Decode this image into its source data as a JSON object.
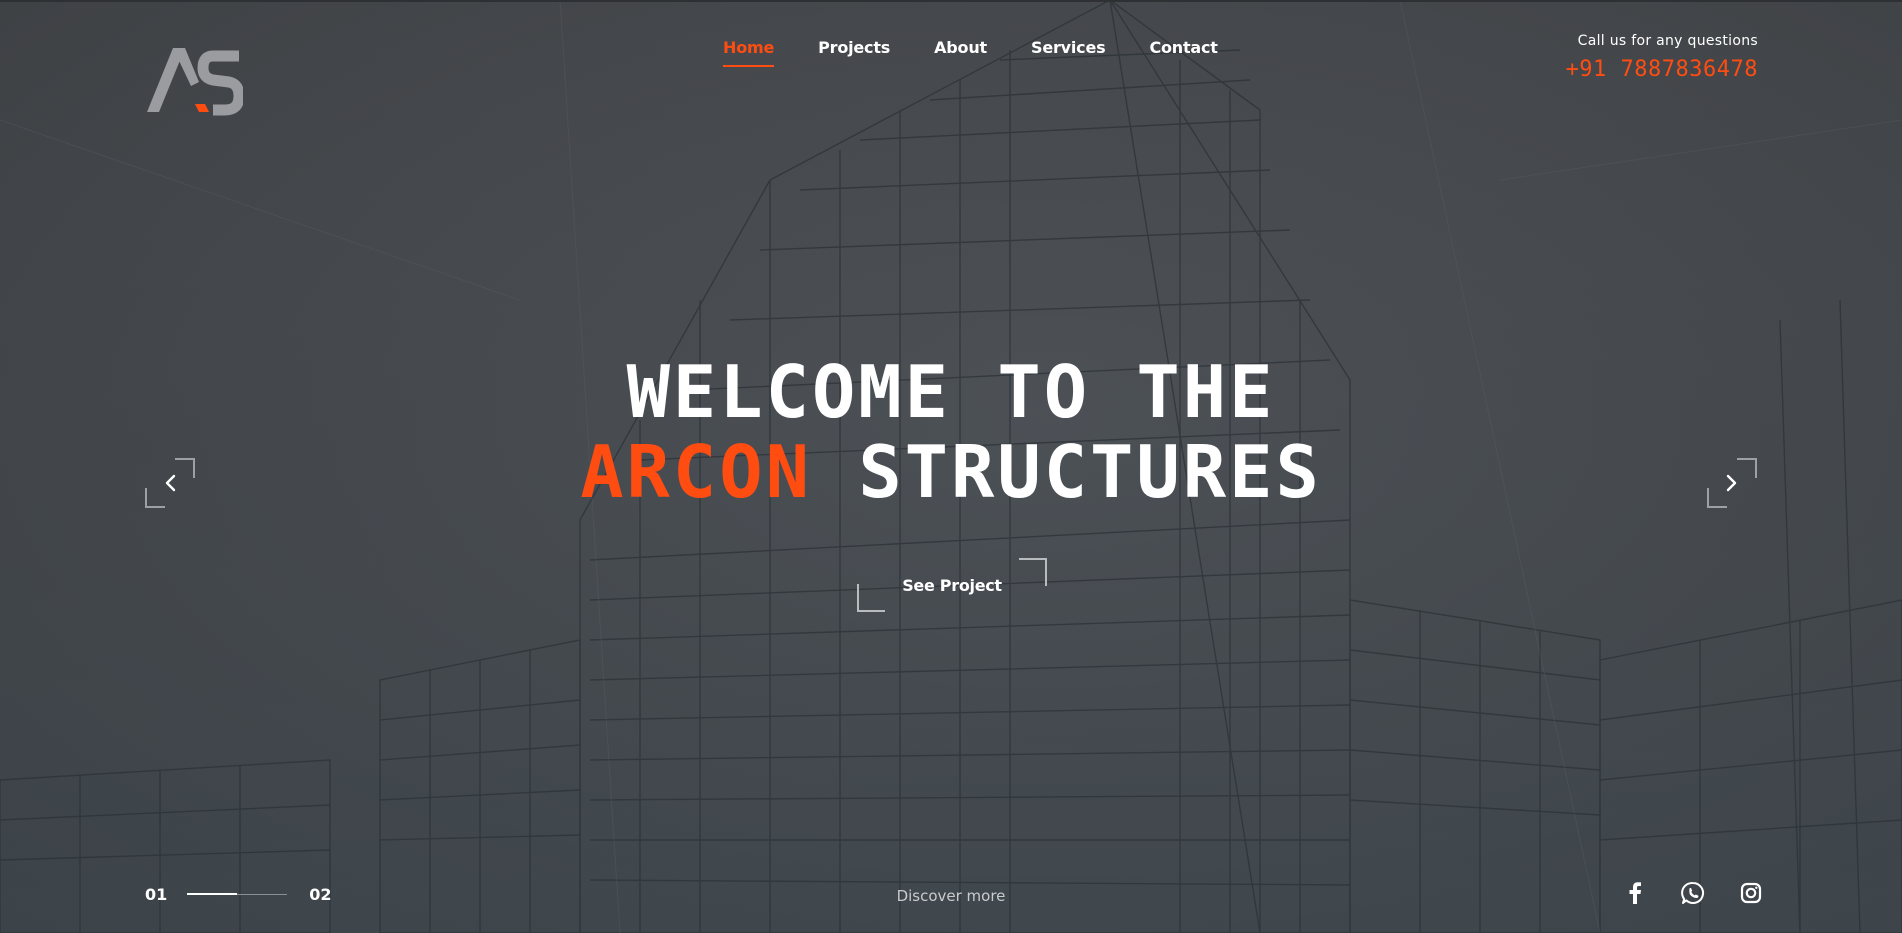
{
  "brand": {
    "logo_text": "AS",
    "accent_color": "#ff4d12"
  },
  "nav": {
    "items": [
      {
        "label": "Home",
        "active": true
      },
      {
        "label": "Projects",
        "active": false
      },
      {
        "label": "About",
        "active": false
      },
      {
        "label": "Services",
        "active": false
      },
      {
        "label": "Contact",
        "active": false
      }
    ]
  },
  "contact": {
    "label": "Call us for any questions",
    "phone": "+91 7887836478"
  },
  "hero": {
    "line1": "WELCOME TO THE",
    "line2_accent": "ARCON",
    "line2_rest": "STRUCTURES",
    "cta_label": "See Project"
  },
  "slider": {
    "current": "01",
    "next": "02",
    "progress_fraction": 0.5
  },
  "discover_label": "Discover more",
  "social": {
    "icons": [
      "facebook-icon",
      "whatsapp-icon",
      "instagram-icon"
    ]
  },
  "icons": {
    "prev": "chevron-left-icon",
    "next": "chevron-right-icon"
  }
}
